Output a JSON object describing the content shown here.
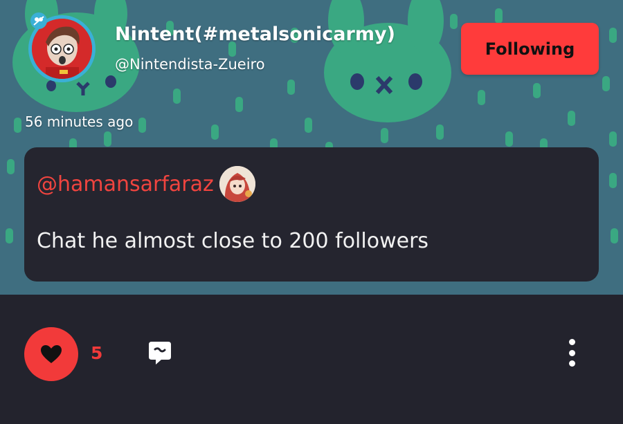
{
  "post": {
    "author_name": "Nintent(#metalsonicarmy)",
    "author_handle": "@Nintendista-Zueiro",
    "follow_label": "Following",
    "timestamp": "56 minutes ago",
    "mention": "@hamansarfaraz",
    "text": "Chat he almost close to 200 followers"
  },
  "actions": {
    "like_count": "5"
  },
  "colors": {
    "accent": "#ff3b3b",
    "banner": "#3f6e80",
    "banner_shape": "#3aa882",
    "card": "#25252f",
    "background": "#23232d"
  },
  "icons": {
    "like": "heart-icon",
    "comment": "comment-icon",
    "more": "more-vertical-icon"
  }
}
